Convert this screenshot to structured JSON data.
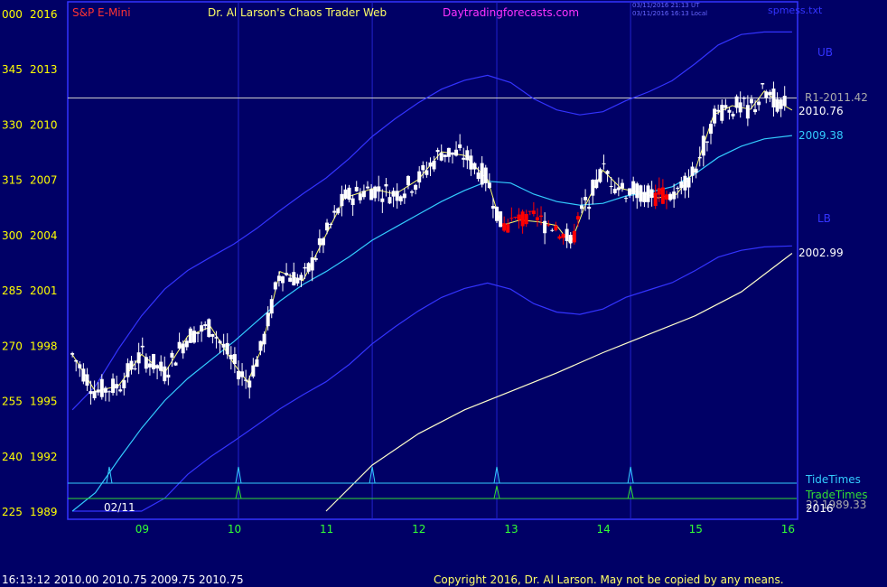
{
  "header": {
    "instrument": "S&P E-Mini",
    "title": "Dr. Al Larson's Chaos Trader Web",
    "site": "Daytradingforecasts.com",
    "timestamp_utc": "03/11/2016 21:13 UT",
    "timestamp_local": "03/11/2016 16:13 Local",
    "file": "spmess.txt"
  },
  "footer": {
    "quote": "16:13:12  2010.00  2010.75  2009.75  2010.75",
    "copyright": "Copyright 2016, Dr. Al Larson. May not be copied by any means."
  },
  "labels": {
    "ub": "UB",
    "lb": "LB",
    "r1": "R1-2011.42",
    "last_price": "2010.76",
    "ma_fast_value": "2009.38",
    "ma_slow_value": "2002.99",
    "tide_times": "TideTimes",
    "trade_times": "TradeTimes",
    "year": "2016",
    "bottom_value": "2? 1989.33",
    "start_date": "02/11"
  },
  "colors": {
    "background": "#000066",
    "border": "#3333ff",
    "grid": "#2222cc",
    "up_bar": "#ffffff",
    "down_bar": "#ff0000",
    "ma_fast": "#ffff66",
    "ma_mid": "#33ccff",
    "band": "#3333ff",
    "ma_slow": "#ffffcc",
    "tide": "#33ccff",
    "trade": "#33dd33",
    "ylabel": "#ffff00",
    "xlabel": "#33ff33",
    "instrument": "#ff3333",
    "site": "#ff33ff"
  },
  "chart_data": {
    "type": "line",
    "ylim": [
      1989,
      2016
    ],
    "xlim": [
      8.2,
      16.1
    ],
    "y_ticks": [
      {
        "left": "000",
        "right": "2016",
        "value": 2016
      },
      {
        "left": "345",
        "right": "2013",
        "value": 2013
      },
      {
        "left": "330",
        "right": "2010",
        "value": 2010
      },
      {
        "left": "315",
        "right": "2007",
        "value": 2007
      },
      {
        "left": "300",
        "right": "2004",
        "value": 2004
      },
      {
        "left": "285",
        "right": "2001",
        "value": 2001
      },
      {
        "left": "270",
        "right": "1998",
        "value": 1998
      },
      {
        "left": "255",
        "right": "1995",
        "value": 1995
      },
      {
        "left": "240",
        "right": "1992",
        "value": 1992
      },
      {
        "left": "225",
        "right": "1989",
        "value": 1989
      }
    ],
    "x_ticks": [
      "09",
      "10",
      "11",
      "12",
      "13",
      "14",
      "15",
      "16"
    ],
    "x_tick_values": [
      9,
      10,
      11,
      12,
      13,
      14,
      15,
      16
    ],
    "vlines": [
      10.05,
      11.5,
      12.85,
      14.3
    ],
    "r1_level": 2011.42,
    "tide_times": [
      8.65,
      10.05,
      11.5,
      12.85,
      14.3
    ],
    "trade_times": [
      10.05,
      12.85,
      14.3
    ],
    "series": [
      {
        "name": "price",
        "x": [
          8.25,
          8.5,
          8.75,
          9.0,
          9.25,
          9.5,
          9.75,
          10.0,
          10.15,
          10.3,
          10.5,
          10.75,
          11.0,
          11.2,
          11.5,
          11.75,
          12.0,
          12.25,
          12.5,
          12.75,
          12.9,
          13.1,
          13.3,
          13.5,
          13.65,
          13.8,
          14.0,
          14.2,
          14.4,
          14.6,
          14.8,
          15.0,
          15.2,
          15.4,
          15.6,
          15.75,
          15.9,
          16.05
        ],
        "y": [
          1997.5,
          1995.5,
          1995.8,
          1997.5,
          1996.5,
          1998.5,
          1999.0,
          1997.0,
          1996.0,
          1997.8,
          2002.0,
          2001.5,
          2004.0,
          2006.0,
          2006.5,
          2006.2,
          2007.0,
          2008.5,
          2008.3,
          2007.0,
          2004.5,
          2004.8,
          2004.7,
          2004.5,
          2003.5,
          2005.5,
          2007.5,
          2006.5,
          2006.3,
          2006.0,
          2006.2,
          2007.5,
          2010.5,
          2011.0,
          2010.8,
          2011.8,
          2011.2,
          2010.76
        ]
      },
      {
        "name": "2009.38",
        "x": [
          8.25,
          8.5,
          8.75,
          9.0,
          9.25,
          9.5,
          9.75,
          10.0,
          10.25,
          10.5,
          10.75,
          11.0,
          11.25,
          11.5,
          11.75,
          12.0,
          12.25,
          12.5,
          12.75,
          13.0,
          13.25,
          13.5,
          13.75,
          14.0,
          14.25,
          14.5,
          14.75,
          15.0,
          15.25,
          15.5,
          15.75,
          16.05
        ],
        "y": [
          1989.0,
          1990.0,
          1991.8,
          1993.5,
          1995.0,
          1996.2,
          1997.2,
          1998.2,
          1999.3,
          2000.4,
          2001.3,
          2002.0,
          2002.8,
          2003.7,
          2004.4,
          2005.1,
          2005.8,
          2006.4,
          2006.9,
          2006.8,
          2006.2,
          2005.8,
          2005.6,
          2005.7,
          2006.1,
          2006.3,
          2006.6,
          2007.3,
          2008.2,
          2008.8,
          2009.2,
          2009.38
        ]
      },
      {
        "name": "2002.99",
        "x": [
          11.0,
          11.5,
          12.0,
          12.5,
          13.0,
          13.5,
          14.0,
          14.5,
          15.0,
          15.5,
          16.05
        ],
        "y": [
          1989.0,
          1991.5,
          1993.2,
          1994.5,
          1995.5,
          1996.5,
          1997.6,
          1998.6,
          1999.6,
          2000.9,
          2002.99
        ]
      }
    ]
  }
}
